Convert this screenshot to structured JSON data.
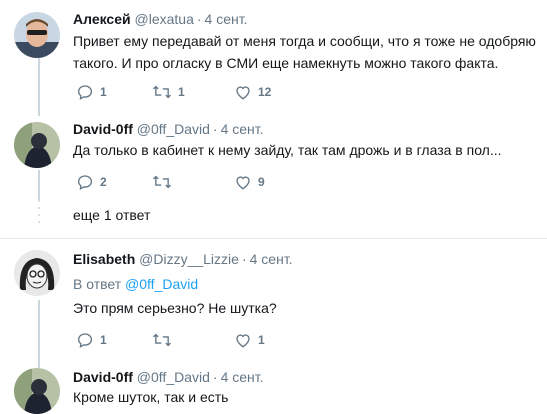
{
  "tweets": [
    {
      "name": "Алексей",
      "handle": "@lexatua",
      "time": "4 сент.",
      "lines": [
        "Привет ему передавай от меня тогда и сообщи, что я тоже не одобряю",
        "такого. И про огласку в СМИ еще намекнуть можно такого факта."
      ],
      "reply_count": "1",
      "retweet_count": "1",
      "like_count": "12"
    },
    {
      "name": "David-0ff",
      "handle": "@0ff_David",
      "time": "4 сент.",
      "lines": [
        "Да только в кабинет к нему зайду, так там дрожь и в глаза в пол..."
      ],
      "reply_count": "2",
      "retweet_count": "",
      "like_count": "9"
    },
    {
      "name": "Elisabeth",
      "handle": "@Dizzy__Lizzie",
      "time": "4 сент.",
      "reply_prefix": "В ответ",
      "reply_to": "@0ff_David",
      "lines": [
        "Это прям серьезно? Не шутка?"
      ],
      "reply_count": "1",
      "retweet_count": "",
      "like_count": "1"
    },
    {
      "name": "David-0ff",
      "handle": "@0ff_David",
      "time": "4 сент.",
      "lines": [
        "Кроме шуток, так и есть"
      ]
    }
  ],
  "more_replies": "еще 1 ответ",
  "separator": "·",
  "icons": [
    "reply-icon",
    "retweet-icon",
    "like-icon"
  ],
  "colors": {
    "muted": "#657786",
    "link": "#1da1f2",
    "thread": "#ccd6dd",
    "border": "#e6ecf0"
  }
}
